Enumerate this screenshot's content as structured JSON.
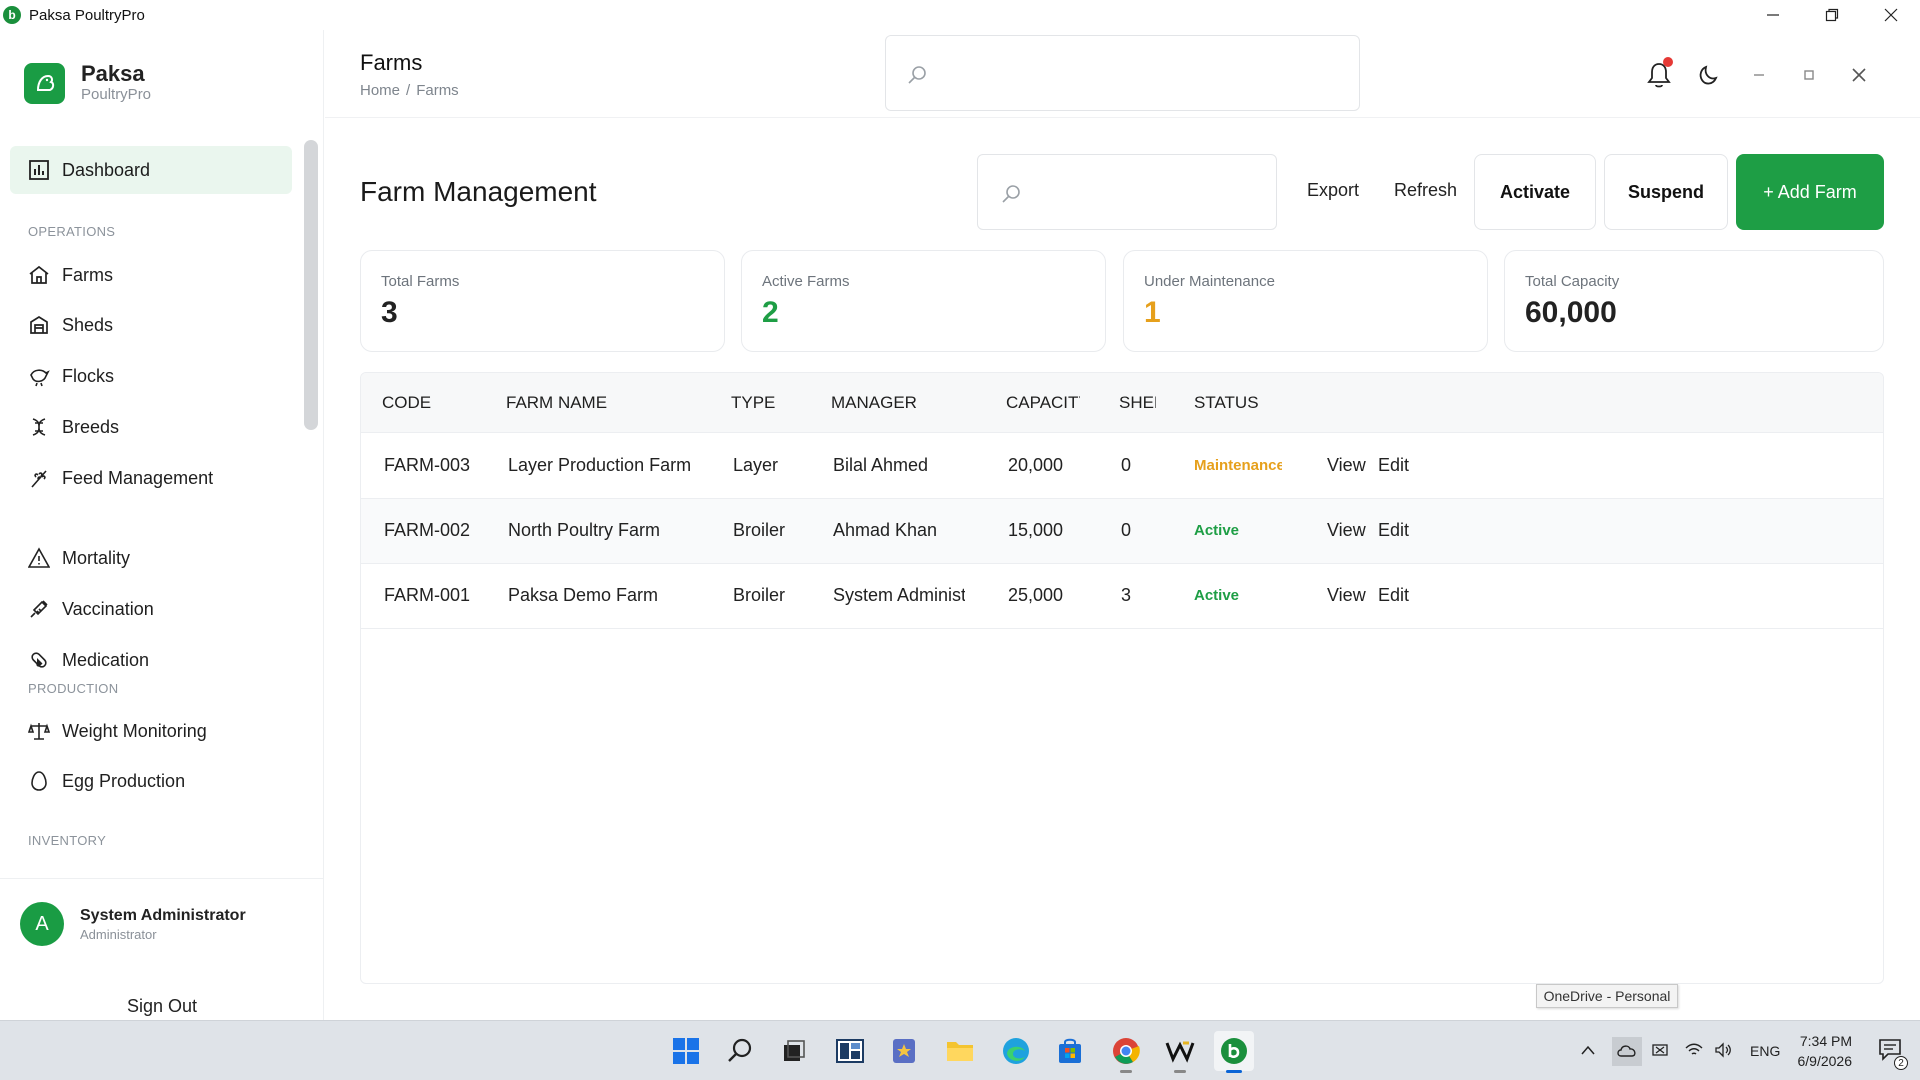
{
  "window": {
    "title": "Paksa PoultryPro",
    "icon_letter": "b"
  },
  "brand": {
    "name": "Paksa",
    "sub": "PoultryPro"
  },
  "sidebar": {
    "active": {
      "label": "Dashboard"
    },
    "sections": {
      "operations": "OPERATIONS",
      "production": "PRODUCTION",
      "inventory": "INVENTORY"
    },
    "items": [
      {
        "label": "Farms"
      },
      {
        "label": "Sheds"
      },
      {
        "label": "Flocks"
      },
      {
        "label": "Breeds"
      },
      {
        "label": "Feed Management"
      },
      {
        "label": "Mortality"
      },
      {
        "label": "Vaccination"
      },
      {
        "label": "Medication"
      },
      {
        "label": "Weight Monitoring"
      },
      {
        "label": "Egg Production"
      }
    ]
  },
  "user": {
    "initial": "A",
    "name": "System Administrator",
    "role": "Administrator",
    "signout": "Sign Out"
  },
  "header": {
    "title": "Farms",
    "breadcrumb": {
      "home": "Home",
      "sep": "/",
      "current": "Farms"
    },
    "search_placeholder": ""
  },
  "toolbar": {
    "title": "Farm Management",
    "search_placeholder": "",
    "export": "Export",
    "refresh": "Refresh",
    "activate": "Activate",
    "suspend": "Suspend",
    "add": "+ Add Farm"
  },
  "stats": [
    {
      "label": "Total Farms",
      "value": "3",
      "color": "#222222"
    },
    {
      "label": "Active Farms",
      "value": "2",
      "color": "#1e9e45"
    },
    {
      "label": "Under Maintenance",
      "value": "1",
      "color": "#e6a01c"
    },
    {
      "label": "Total Capacity",
      "value": "60,000",
      "color": "#222222"
    }
  ],
  "table": {
    "headers": [
      "CODE",
      "FARM NAME",
      "TYPE",
      "MANAGER",
      "CAPACITY",
      "SHEDS",
      "STATUS"
    ],
    "rows": [
      {
        "code": "FARM-003",
        "name": "Layer Production Farm",
        "type": "Layer",
        "manager": "Bilal Ahmed",
        "capacity": "20,000",
        "sheds": "0",
        "status": "Maintenance",
        "view": "View",
        "edit": "Edit"
      },
      {
        "code": "FARM-002",
        "name": "North Poultry Farm",
        "type": "Broiler",
        "manager": "Ahmad Khan",
        "capacity": "15,000",
        "sheds": "0",
        "status": "Active",
        "view": "View",
        "edit": "Edit"
      },
      {
        "code": "FARM-001",
        "name": "Paksa Demo Farm",
        "type": "Broiler",
        "manager": "System Administrator",
        "capacity": "25,000",
        "sheds": "3",
        "status": "Active",
        "view": "View",
        "edit": "Edit"
      }
    ]
  },
  "tooltip": "OneDrive - Personal",
  "taskbar": {
    "lang": "ENG",
    "time": "7:34 PM",
    "date": "6/9/2026",
    "notif_count": "2"
  },
  "colors": {
    "accent": "#1e9e45",
    "warning": "#e6a01c",
    "active_bg": "#eaf6ee"
  }
}
